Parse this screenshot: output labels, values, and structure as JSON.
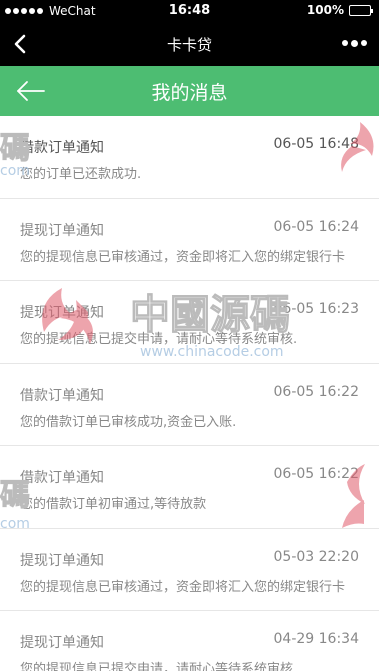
{
  "status_bar": {
    "carrier": "WeChat",
    "time": "16:48",
    "battery": "100%",
    "battery_level": 1.0
  },
  "wechat_nav": {
    "title": "卡卡贷"
  },
  "header": {
    "title": "我的消息"
  },
  "messages": [
    {
      "type": "借款订单通知",
      "time": "06-05 16:48",
      "content": "您的订单已还款成功."
    },
    {
      "type": "提现订单通知",
      "time": "06-05 16:24",
      "content": "您的提现信息已审核通过，资金即将汇入您的绑定银行卡"
    },
    {
      "type": "提现订单通知",
      "time": "06-05 16:23",
      "content": "您的提现信息已提交申请，请耐心等待系统审核."
    },
    {
      "type": "借款订单通知",
      "time": "06-05 16:22",
      "content": "您的借款订单已审核成功,资金已入账."
    },
    {
      "type": "借款订单通知",
      "time": "06-05 16:22",
      "content": "您的借款订单初审通过,等待放款"
    },
    {
      "type": "提现订单通知",
      "time": "05-03 22:20",
      "content": "您的提现信息已审核通过，资金即将汇入您的绑定银行卡"
    },
    {
      "type": "提现订单通知",
      "time": "04-29 16:34",
      "content": "您的提现信息已提交申请，请耐心等待系统审核."
    }
  ],
  "watermark": {
    "brand": "中國源碼",
    "url": "www.chinacode.com",
    "fragment_left": "碼",
    "fragment_com": "com"
  },
  "colors": {
    "header_green": "#4dbd72",
    "nav_black": "#000000",
    "text_gray": "#888888"
  }
}
